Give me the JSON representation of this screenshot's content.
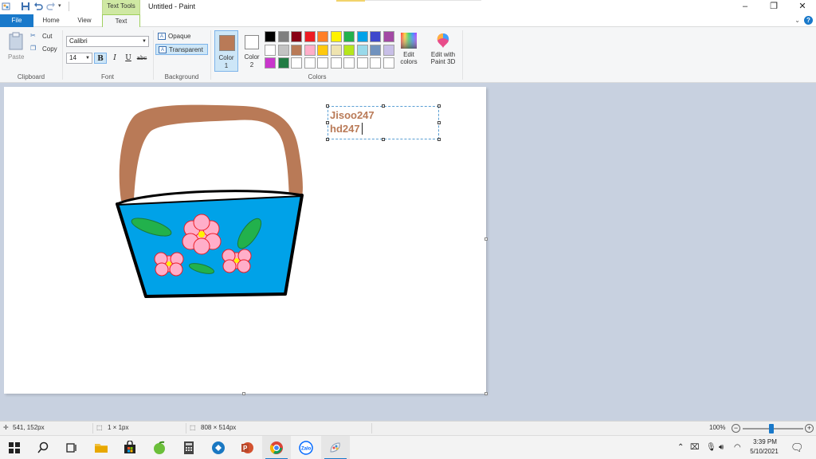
{
  "window": {
    "title": "Untitled - Paint",
    "context_tab": "Text Tools"
  },
  "tabs": [
    {
      "label": "File"
    },
    {
      "label": "Home"
    },
    {
      "label": "View"
    },
    {
      "label": "Text"
    }
  ],
  "clipboard": {
    "paste": "Paste",
    "cut": "Cut",
    "copy": "Copy",
    "group": "Clipboard"
  },
  "font": {
    "name": "Calibri",
    "size": "14",
    "bold": "B",
    "italic": "I",
    "underline": "U",
    "strike": "abc",
    "group": "Font"
  },
  "background": {
    "opaque": "Opaque",
    "transparent": "Transparent",
    "selected": "transparent",
    "group": "Background"
  },
  "colors": {
    "color1_label": "Color",
    "color1_num": "1",
    "color2_label": "Color",
    "color2_num": "2",
    "color1": "#b97a57",
    "color2": "#ffffff",
    "edit_colors_1": "Edit",
    "edit_colors_2": "colors",
    "edit_paint3d_1": "Edit with",
    "edit_paint3d_2": "Paint 3D",
    "group": "Colors",
    "palette": [
      "#000000",
      "#7f7f7f",
      "#880015",
      "#ed1c24",
      "#ff7f27",
      "#fff200",
      "#22b14c",
      "#00a2e8",
      "#3f48cc",
      "#a349a4",
      "#ffffff",
      "#c3c3c3",
      "#b97a57",
      "#ffaec9",
      "#ffc90e",
      "#efe4b0",
      "#b5e61d",
      "#99d9ea",
      "#7092be",
      "#c8bfe7",
      "#c936cc",
      "#227b44",
      "#ffffff",
      "#ffffff",
      "#ffffff",
      "#ffffff",
      "#ffffff",
      "#ffffff",
      "#ffffff",
      "#ffffff"
    ]
  },
  "canvas": {
    "text_line1": "Jisoo247",
    "text_line2": "hd247"
  },
  "status": {
    "cursor": "541, 152px",
    "selection": "1 × 1px",
    "size": "808 × 514px",
    "zoom": "100%",
    "zoom_out": "−",
    "zoom_in": "+"
  },
  "taskbar": {
    "time": "3:39 PM",
    "date": "5/10/2021"
  }
}
